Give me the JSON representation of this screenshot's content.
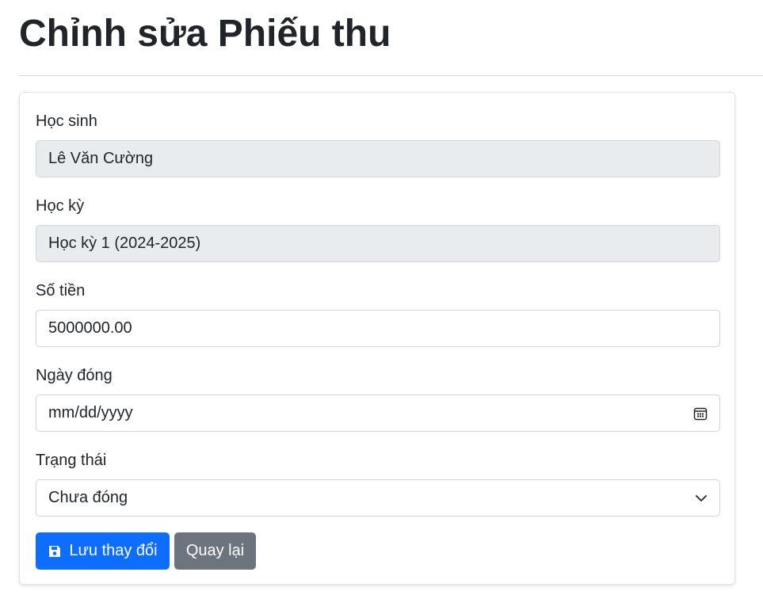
{
  "page": {
    "title": "Chỉnh sửa Phiếu thu"
  },
  "form": {
    "student": {
      "label": "Học sinh",
      "value": "Lê Văn Cường"
    },
    "semester": {
      "label": "Học kỳ",
      "value": "Học kỳ 1 (2024-2025)"
    },
    "amount": {
      "label": "Số tiền",
      "value": "5000000.00"
    },
    "payment_date": {
      "label": "Ngày đóng",
      "placeholder": "mm/dd/yyyy",
      "icon": "calendar-icon"
    },
    "status": {
      "label": "Trạng thái",
      "selected": "Chưa đóng",
      "icon": "chevron-down-icon"
    }
  },
  "actions": {
    "save_label": "Lưu thay đổi",
    "save_icon": "save-icon",
    "back_label": "Quay lại"
  },
  "colors": {
    "primary": "#0d6efd",
    "secondary": "#6c757d",
    "readonly_bg": "#e9ecef",
    "border": "#ced4da"
  }
}
